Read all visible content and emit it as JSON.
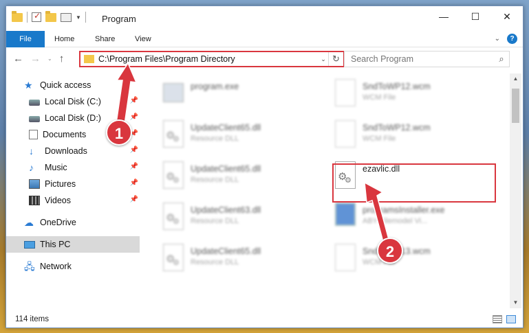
{
  "window": {
    "title": "Program"
  },
  "ribbon": {
    "tabs": [
      "File",
      "Home",
      "Share",
      "View"
    ]
  },
  "navigation": {
    "address_path": "C:\\Program Files\\Program Directory",
    "search_placeholder": "Search Program"
  },
  "sidebar": {
    "items": [
      {
        "label": "Quick access",
        "icon": "star-icon",
        "pinned": false
      },
      {
        "label": "Local Disk (C:)",
        "icon": "disk-icon",
        "pinned": true
      },
      {
        "label": "Local Disk (D:)",
        "icon": "disk-icon",
        "pinned": true
      },
      {
        "label": "Documents",
        "icon": "documents-icon",
        "pinned": true
      },
      {
        "label": "Downloads",
        "icon": "download-icon",
        "pinned": true
      },
      {
        "label": "Music",
        "icon": "music-icon",
        "pinned": true
      },
      {
        "label": "Pictures",
        "icon": "pictures-icon",
        "pinned": true
      },
      {
        "label": "Videos",
        "icon": "videos-icon",
        "pinned": true
      },
      {
        "label": "OneDrive",
        "icon": "cloud-icon",
        "pinned": false
      },
      {
        "label": "This PC",
        "icon": "pc-icon",
        "pinned": false,
        "selected": true
      },
      {
        "label": "Network",
        "icon": "network-icon",
        "pinned": false
      }
    ]
  },
  "files": {
    "col1": [
      {
        "name": "program.exe",
        "type": ""
      },
      {
        "name": "UpdateClient65.dll",
        "type": "Resource DLL"
      },
      {
        "name": "UpdateClient65.dll",
        "type": "Resource DLL"
      },
      {
        "name": "UpdateClient63.dll",
        "type": "Resource DLL"
      },
      {
        "name": "UpdateClient65.dll",
        "type": "Resource DLL"
      }
    ],
    "col2": [
      {
        "name": "SndToWP12.wcm",
        "type": "WCM File"
      },
      {
        "name": "SndToWP12.wcm",
        "type": "WCM File"
      },
      {
        "name": "ezavlic.dll",
        "type": ""
      },
      {
        "name": "programsInstaller.exe",
        "type": "ABY Filemodel Vi..."
      },
      {
        "name": "SndToWP13.wcm",
        "type": "WCM File"
      }
    ]
  },
  "status": {
    "item_count": "114 items"
  },
  "annotations": {
    "step1": "1",
    "step2": "2",
    "color": "#d9363e"
  }
}
